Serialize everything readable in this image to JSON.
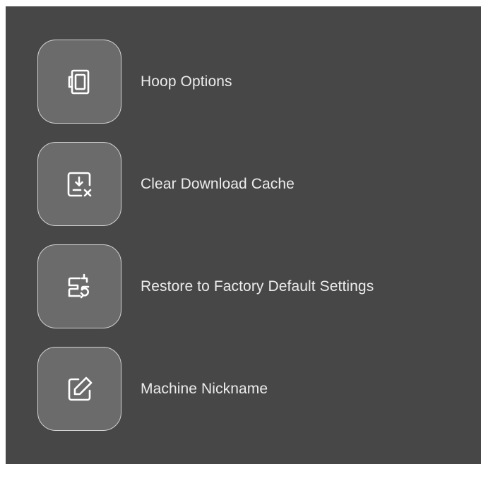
{
  "menu": {
    "items": [
      {
        "label": "Hoop Options",
        "icon": "hoop-icon"
      },
      {
        "label": "Clear Download Cache",
        "icon": "clear-download-icon"
      },
      {
        "label": "Restore to Factory Default Settings",
        "icon": "restore-machine-icon"
      },
      {
        "label": "Machine Nickname",
        "icon": "edit-icon"
      }
    ]
  },
  "colors": {
    "panel_background": "#474747",
    "tile_background": "#6b6b6b",
    "tile_border": "#d2d2d2",
    "text": "#ececec"
  }
}
